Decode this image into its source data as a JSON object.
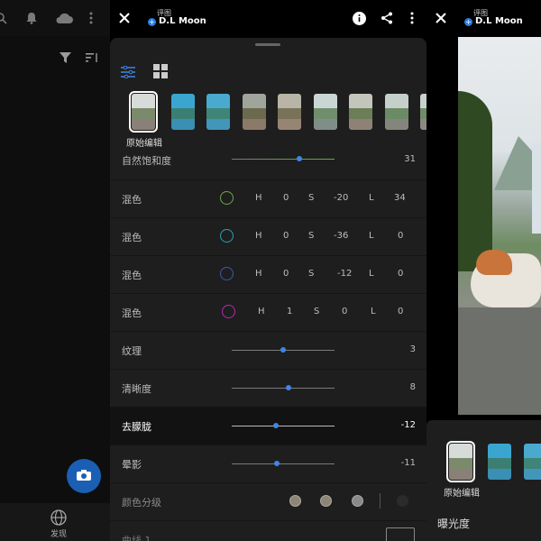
{
  "left": {
    "icons": [
      "search-icon",
      "bell-icon",
      "cloud-icon",
      "more-vert-icon",
      "filter-icon",
      "sort-icon",
      "camera-icon",
      "globe-icon"
    ],
    "nav_label": "发现"
  },
  "header": {
    "small_text": "评图",
    "author": "D.L Moon",
    "author_badge": "+"
  },
  "panel": {
    "preset_label": "原始编辑",
    "partial_row": {
      "label": "自然饱和度",
      "value": "31"
    },
    "rows": [
      {
        "label": "混色",
        "color": "#6aa84f",
        "h": "0",
        "s": "-20",
        "l": "34"
      },
      {
        "label": "混色",
        "color": "#2aa3b8",
        "h": "0",
        "s": "-36",
        "l": "0"
      },
      {
        "label": "混色",
        "color": "#3a5bb0",
        "h": "0",
        "s": "-12",
        "l": "0"
      },
      {
        "label": "混色",
        "color": "#b52bb5",
        "h": "1",
        "s": "0",
        "l": "0"
      }
    ],
    "hsl_labels": {
      "h": "H",
      "s": "S",
      "l": "L"
    },
    "sliders": [
      {
        "label": "纹理",
        "value": "3",
        "pos": 0.5
      },
      {
        "label": "清晰度",
        "value": "8",
        "pos": 0.55
      },
      {
        "label": "去朦胧",
        "value": "-12",
        "pos": 0.43,
        "active": true
      },
      {
        "label": "晕影",
        "value": "-11",
        "pos": 0.44
      }
    ],
    "grading_label": "颜色分级",
    "bottom_partial": "曲线 1"
  },
  "right": {
    "preset_label": "原始编辑",
    "exposure_label": "曝光度"
  },
  "colors": {
    "accent": "#3d86e8",
    "panel": "#1e1e1e",
    "fab": "#1a5fb4"
  }
}
